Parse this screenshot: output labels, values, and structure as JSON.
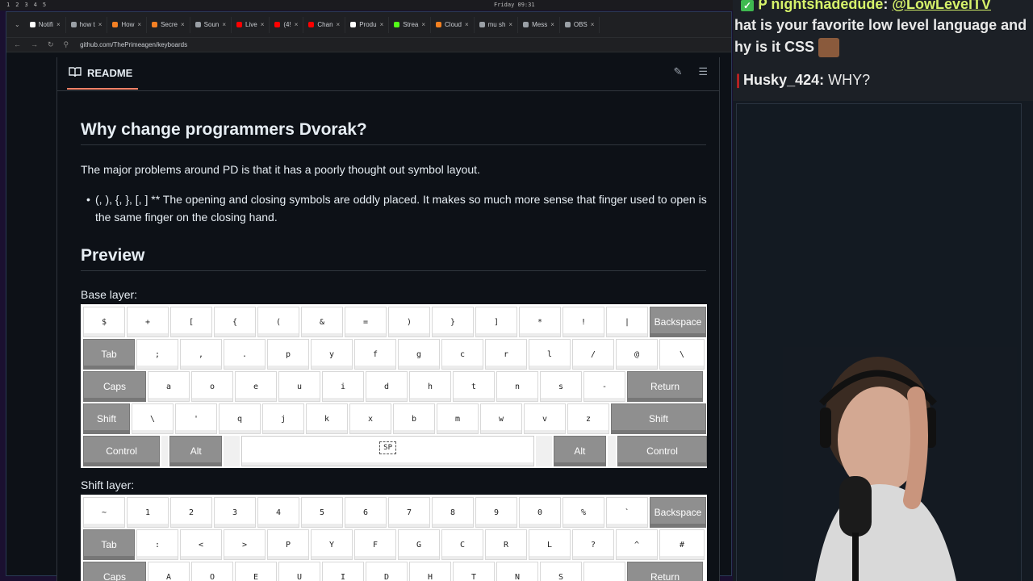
{
  "system_bar": {
    "workspaces": [
      "1",
      "2",
      "3",
      "4",
      "5"
    ],
    "clock": "Friday 09:31"
  },
  "browser": {
    "tabs": [
      {
        "label": "Notifi",
        "color": "#ffffff"
      },
      {
        "label": "how t",
        "color": "#9aa0a6"
      },
      {
        "label": "How",
        "color": "#f48024"
      },
      {
        "label": "Secre",
        "color": "#f48024"
      },
      {
        "label": "Soun",
        "color": "#9aa0a6"
      },
      {
        "label": "Live",
        "color": "#ff0000"
      },
      {
        "label": "(4!",
        "color": "#ff0000"
      },
      {
        "label": "Chan",
        "color": "#ff0000"
      },
      {
        "label": "Produ",
        "color": "#ffffff"
      },
      {
        "label": "Strea",
        "color": "#53fc18"
      },
      {
        "label": "Cloud",
        "color": "#f38020"
      },
      {
        "label": "mu sh",
        "color": "#9aa0a6"
      },
      {
        "label": "Mess",
        "color": "#9aa0a6"
      },
      {
        "label": "OBS",
        "color": "#9aa0a6"
      }
    ],
    "url": "github.com/ThePrimeagen/keyboards"
  },
  "readme": {
    "title": "README",
    "h2_why": "Why change programmers Dvorak?",
    "intro": "The major problems around PD is that it has a poorly thought out symbol layout.",
    "bullet": "(, ), {, }, [, ] ** The opening and closing symbols are oddly placed. It makes so much more sense that finger used to open is the same finger on the closing hand.",
    "h2_preview": "Preview",
    "base_label": "Base layer:",
    "shift_label": "Shift layer:"
  },
  "base_layer": [
    [
      [
        "$",
        52
      ],
      [
        "+",
        52
      ],
      [
        "[",
        52
      ],
      [
        "{",
        52
      ],
      [
        "(",
        52
      ],
      [
        "&",
        52
      ],
      [
        "=",
        52
      ],
      [
        ")",
        52
      ],
      [
        "}",
        52
      ],
      [
        "]",
        52
      ],
      [
        "*",
        52
      ],
      [
        "!",
        52
      ],
      [
        "|",
        52
      ],
      [
        "Backspace",
        70,
        "mod"
      ]
    ],
    [
      [
        "Tab",
        64,
        "mod"
      ],
      [
        ";",
        52
      ],
      [
        ",",
        52
      ],
      [
        ".",
        52
      ],
      [
        "p",
        52
      ],
      [
        "y",
        52
      ],
      [
        "f",
        52
      ],
      [
        "g",
        52
      ],
      [
        "c",
        52
      ],
      [
        "r",
        52
      ],
      [
        "l",
        52
      ],
      [
        "/",
        52
      ],
      [
        "@",
        52
      ],
      [
        "\\",
        56
      ]
    ],
    [
      [
        "Caps",
        78,
        "mod"
      ],
      [
        "a",
        52
      ],
      [
        "o",
        52
      ],
      [
        "e",
        52
      ],
      [
        "u",
        52
      ],
      [
        "i",
        52
      ],
      [
        "d",
        52
      ],
      [
        "h",
        52
      ],
      [
        "t",
        52
      ],
      [
        "n",
        52
      ],
      [
        "s",
        52
      ],
      [
        "-",
        52
      ],
      [
        "Return",
        94,
        "mod"
      ]
    ],
    [
      [
        "Shift",
        58,
        "mod"
      ],
      [
        "\\",
        52
      ],
      [
        "'",
        52
      ],
      [
        "q",
        52
      ],
      [
        "j",
        52
      ],
      [
        "k",
        52
      ],
      [
        "x",
        52
      ],
      [
        "b",
        52
      ],
      [
        "m",
        52
      ],
      [
        "w",
        52
      ],
      [
        "v",
        52
      ],
      [
        "z",
        52
      ],
      [
        "Shift",
        118,
        "mod"
      ]
    ],
    [
      [
        "Control",
        96,
        "mod"
      ],
      [
        "",
        8,
        "gap"
      ],
      [
        "Alt",
        66,
        "mod"
      ],
      [
        "",
        20,
        "gap"
      ],
      [
        "SP",
        366,
        "space"
      ],
      [
        "",
        20,
        "gap"
      ],
      [
        "Alt",
        66,
        "mod"
      ],
      [
        "",
        10,
        "gap"
      ],
      [
        "Control",
        112,
        "mod"
      ]
    ]
  ],
  "shift_layer": [
    [
      [
        "~",
        52
      ],
      [
        "1",
        52
      ],
      [
        "2",
        52
      ],
      [
        "3",
        52
      ],
      [
        "4",
        52
      ],
      [
        "5",
        52
      ],
      [
        "6",
        52
      ],
      [
        "7",
        52
      ],
      [
        "8",
        52
      ],
      [
        "9",
        52
      ],
      [
        "0",
        52
      ],
      [
        "%",
        52
      ],
      [
        "`",
        52
      ],
      [
        "Backspace",
        70,
        "mod"
      ]
    ],
    [
      [
        "Tab",
        64,
        "mod"
      ],
      [
        ":",
        52
      ],
      [
        "<",
        52
      ],
      [
        ">",
        52
      ],
      [
        "P",
        52
      ],
      [
        "Y",
        52
      ],
      [
        "F",
        52
      ],
      [
        "G",
        52
      ],
      [
        "C",
        52
      ],
      [
        "R",
        52
      ],
      [
        "L",
        52
      ],
      [
        "?",
        52
      ],
      [
        "^",
        52
      ],
      [
        "#",
        56
      ]
    ],
    [
      [
        "Caps",
        78,
        "mod"
      ],
      [
        "A",
        52
      ],
      [
        "O",
        52
      ],
      [
        "E",
        52
      ],
      [
        "U",
        52
      ],
      [
        "I",
        52
      ],
      [
        "D",
        52
      ],
      [
        "H",
        52
      ],
      [
        "T",
        52
      ],
      [
        "N",
        52
      ],
      [
        "S",
        52
      ],
      [
        "_",
        52
      ],
      [
        "Return",
        94,
        "mod"
      ]
    ]
  ],
  "chat": {
    "line1_user": "nightshadedude",
    "line1_mention": "@LowLevelTV",
    "line2": "hat is your favorite low level language and",
    "line3": "hy is it CSS",
    "line4_user": "Husky_424",
    "line4_text": "WHY?"
  }
}
